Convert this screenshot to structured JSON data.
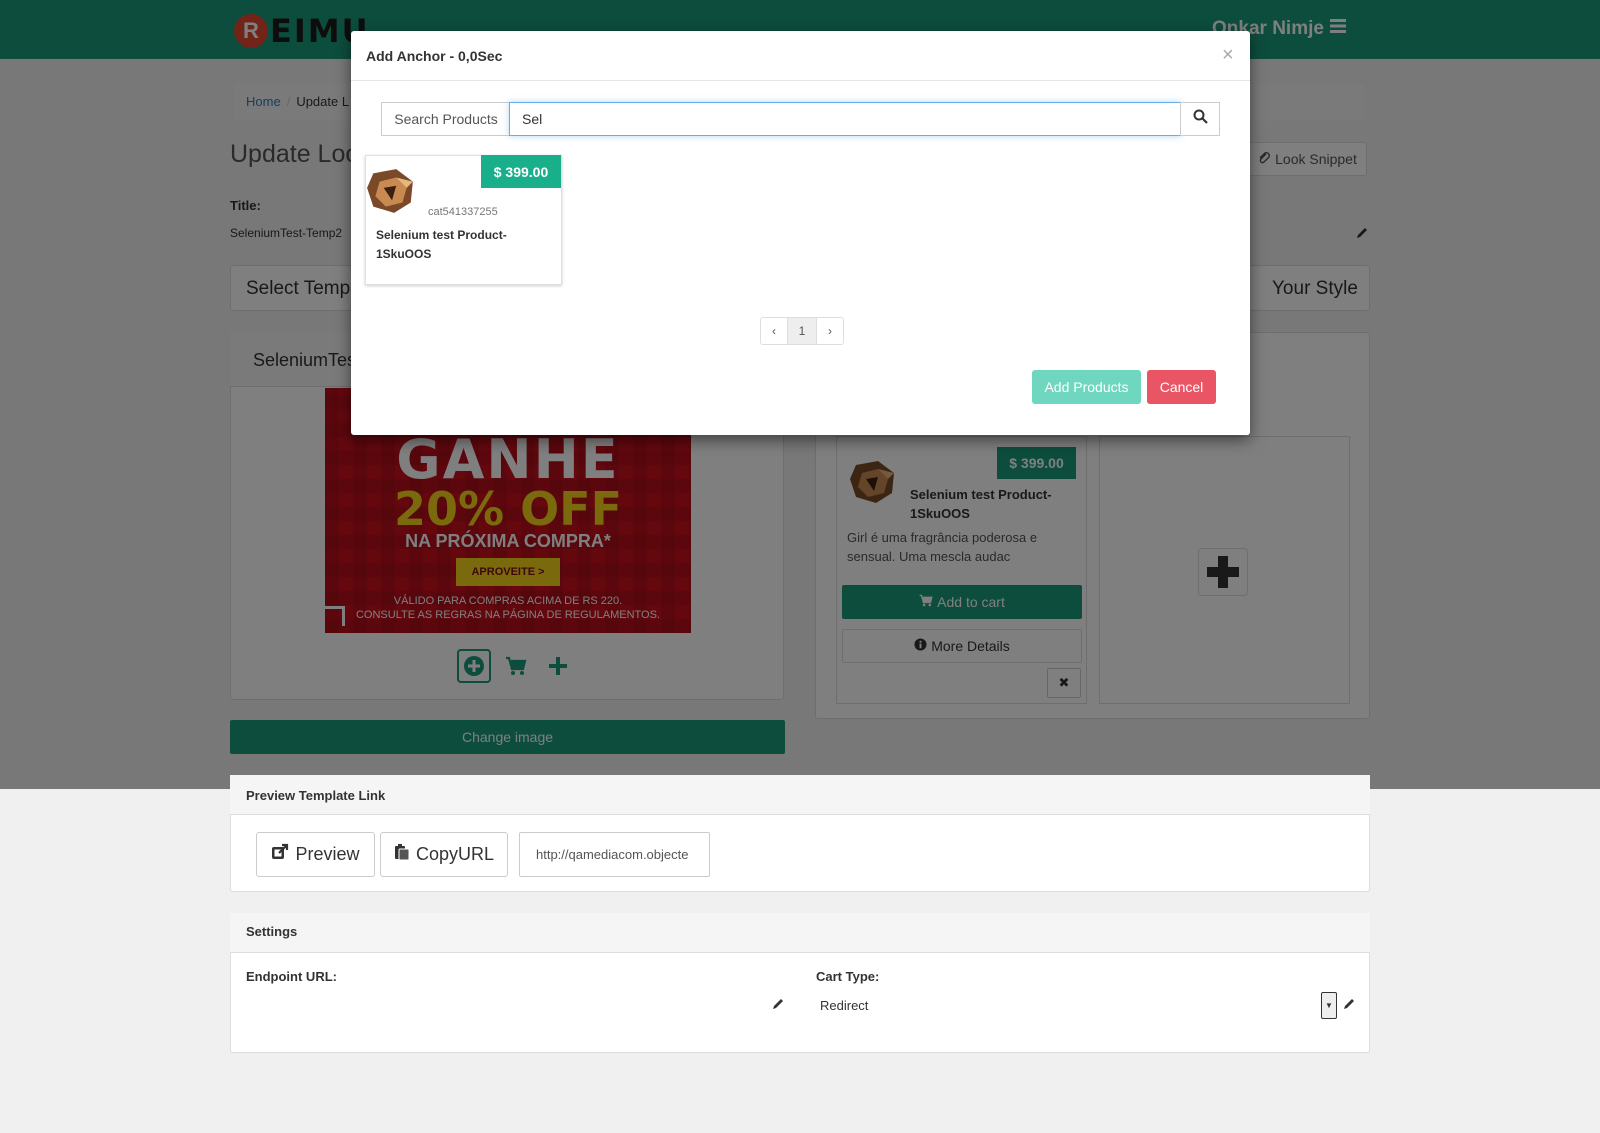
{
  "header": {
    "logo_letter": "R",
    "logo_text": "EIMU",
    "user_name": "Onkar Nimje",
    "menu_icon": "hamburger-icon"
  },
  "breadcrumb": {
    "home": "Home",
    "current": "Update L"
  },
  "page": {
    "title": "Update Loo",
    "snippet_label": "Look Snippet"
  },
  "look": {
    "title_label": "Title:",
    "title_value": "SeleniumTest-Temp2"
  },
  "template": {
    "select_label": "Select Templ",
    "style_label": "Your Style",
    "panel_title": "SeleniumTes"
  },
  "banner": {
    "line1": "GANHE",
    "line2": "20% OFF",
    "line3": "NA PRÓXIMA COMPRA*",
    "cta": "APROVEITE >",
    "fine1": "VÁLIDO PARA COMPRAS ACIMA DE RS 220.",
    "fine2": "CONSULTE AS REGRAS NA PÁGINA DE REGULAMENTOS."
  },
  "image_panel": {
    "change_image": "Change image"
  },
  "product": {
    "price": "$ 399.00",
    "name": "Selenium test Product-1SkuOOS",
    "desc": "Girl é uma fragrância poderosa e sensual. Uma mescla audac",
    "add_to_cart": "Add to cart",
    "more_details": "More Details"
  },
  "preview": {
    "title": "Preview Template Link",
    "preview_label": "Preview",
    "copy_label": "CopyURL",
    "url": "http://qamediacom.objecte"
  },
  "settings": {
    "title": "Settings",
    "endpoint_label": "Endpoint URL:",
    "cart_type_label": "Cart Type:",
    "cart_type_value": "Redirect"
  },
  "modal": {
    "title": "Add Anchor - 0,0Sec",
    "close": "×",
    "search_label": "Search Products",
    "search_value": "Sel",
    "result": {
      "price": "$ 399.00",
      "sku": "cat541337255",
      "name": "Selenium test Product-1SkuOOS"
    },
    "pager": {
      "prev": "‹",
      "page": "1",
      "next": "›"
    },
    "add_products": "Add Products",
    "cancel": "Cancel"
  },
  "colors": {
    "brand": "#1a9a7b",
    "danger": "#ea5566",
    "accent_light": "#6fd6bf",
    "link": "#337ab7"
  }
}
